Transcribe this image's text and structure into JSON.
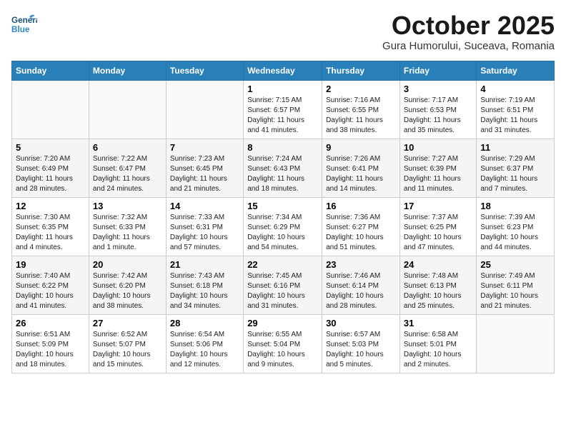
{
  "header": {
    "logo_line1": "General",
    "logo_line2": "Blue",
    "month": "October 2025",
    "location": "Gura Humorului, Suceava, Romania"
  },
  "weekdays": [
    "Sunday",
    "Monday",
    "Tuesday",
    "Wednesday",
    "Thursday",
    "Friday",
    "Saturday"
  ],
  "weeks": [
    [
      {
        "day": "",
        "info": ""
      },
      {
        "day": "",
        "info": ""
      },
      {
        "day": "",
        "info": ""
      },
      {
        "day": "1",
        "info": "Sunrise: 7:15 AM\nSunset: 6:57 PM\nDaylight: 11 hours and 41 minutes."
      },
      {
        "day": "2",
        "info": "Sunrise: 7:16 AM\nSunset: 6:55 PM\nDaylight: 11 hours and 38 minutes."
      },
      {
        "day": "3",
        "info": "Sunrise: 7:17 AM\nSunset: 6:53 PM\nDaylight: 11 hours and 35 minutes."
      },
      {
        "day": "4",
        "info": "Sunrise: 7:19 AM\nSunset: 6:51 PM\nDaylight: 11 hours and 31 minutes."
      }
    ],
    [
      {
        "day": "5",
        "info": "Sunrise: 7:20 AM\nSunset: 6:49 PM\nDaylight: 11 hours and 28 minutes."
      },
      {
        "day": "6",
        "info": "Sunrise: 7:22 AM\nSunset: 6:47 PM\nDaylight: 11 hours and 24 minutes."
      },
      {
        "day": "7",
        "info": "Sunrise: 7:23 AM\nSunset: 6:45 PM\nDaylight: 11 hours and 21 minutes."
      },
      {
        "day": "8",
        "info": "Sunrise: 7:24 AM\nSunset: 6:43 PM\nDaylight: 11 hours and 18 minutes."
      },
      {
        "day": "9",
        "info": "Sunrise: 7:26 AM\nSunset: 6:41 PM\nDaylight: 11 hours and 14 minutes."
      },
      {
        "day": "10",
        "info": "Sunrise: 7:27 AM\nSunset: 6:39 PM\nDaylight: 11 hours and 11 minutes."
      },
      {
        "day": "11",
        "info": "Sunrise: 7:29 AM\nSunset: 6:37 PM\nDaylight: 11 hours and 7 minutes."
      }
    ],
    [
      {
        "day": "12",
        "info": "Sunrise: 7:30 AM\nSunset: 6:35 PM\nDaylight: 11 hours and 4 minutes."
      },
      {
        "day": "13",
        "info": "Sunrise: 7:32 AM\nSunset: 6:33 PM\nDaylight: 11 hours and 1 minute."
      },
      {
        "day": "14",
        "info": "Sunrise: 7:33 AM\nSunset: 6:31 PM\nDaylight: 10 hours and 57 minutes."
      },
      {
        "day": "15",
        "info": "Sunrise: 7:34 AM\nSunset: 6:29 PM\nDaylight: 10 hours and 54 minutes."
      },
      {
        "day": "16",
        "info": "Sunrise: 7:36 AM\nSunset: 6:27 PM\nDaylight: 10 hours and 51 minutes."
      },
      {
        "day": "17",
        "info": "Sunrise: 7:37 AM\nSunset: 6:25 PM\nDaylight: 10 hours and 47 minutes."
      },
      {
        "day": "18",
        "info": "Sunrise: 7:39 AM\nSunset: 6:23 PM\nDaylight: 10 hours and 44 minutes."
      }
    ],
    [
      {
        "day": "19",
        "info": "Sunrise: 7:40 AM\nSunset: 6:22 PM\nDaylight: 10 hours and 41 minutes."
      },
      {
        "day": "20",
        "info": "Sunrise: 7:42 AM\nSunset: 6:20 PM\nDaylight: 10 hours and 38 minutes."
      },
      {
        "day": "21",
        "info": "Sunrise: 7:43 AM\nSunset: 6:18 PM\nDaylight: 10 hours and 34 minutes."
      },
      {
        "day": "22",
        "info": "Sunrise: 7:45 AM\nSunset: 6:16 PM\nDaylight: 10 hours and 31 minutes."
      },
      {
        "day": "23",
        "info": "Sunrise: 7:46 AM\nSunset: 6:14 PM\nDaylight: 10 hours and 28 minutes."
      },
      {
        "day": "24",
        "info": "Sunrise: 7:48 AM\nSunset: 6:13 PM\nDaylight: 10 hours and 25 minutes."
      },
      {
        "day": "25",
        "info": "Sunrise: 7:49 AM\nSunset: 6:11 PM\nDaylight: 10 hours and 21 minutes."
      }
    ],
    [
      {
        "day": "26",
        "info": "Sunrise: 6:51 AM\nSunset: 5:09 PM\nDaylight: 10 hours and 18 minutes."
      },
      {
        "day": "27",
        "info": "Sunrise: 6:52 AM\nSunset: 5:07 PM\nDaylight: 10 hours and 15 minutes."
      },
      {
        "day": "28",
        "info": "Sunrise: 6:54 AM\nSunset: 5:06 PM\nDaylight: 10 hours and 12 minutes."
      },
      {
        "day": "29",
        "info": "Sunrise: 6:55 AM\nSunset: 5:04 PM\nDaylight: 10 hours and 9 minutes."
      },
      {
        "day": "30",
        "info": "Sunrise: 6:57 AM\nSunset: 5:03 PM\nDaylight: 10 hours and 5 minutes."
      },
      {
        "day": "31",
        "info": "Sunrise: 6:58 AM\nSunset: 5:01 PM\nDaylight: 10 hours and 2 minutes."
      },
      {
        "day": "",
        "info": ""
      }
    ]
  ]
}
